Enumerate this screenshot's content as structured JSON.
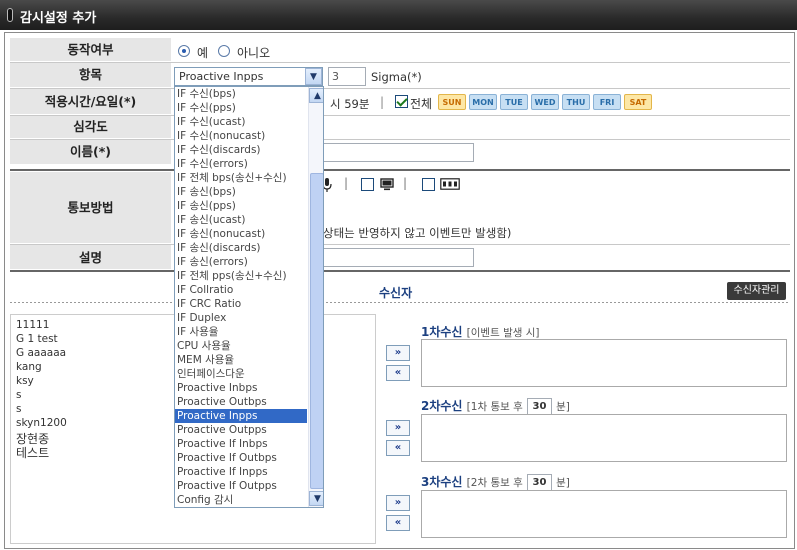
{
  "window": {
    "title": "감시설정 추가"
  },
  "form": {
    "operation": {
      "label": "동작여부",
      "yes": "예",
      "no": "아니오",
      "selected": "예"
    },
    "item": {
      "label": "항목",
      "selected": "Proactive Inpps",
      "value": "3",
      "unit": "Sigma(*)"
    },
    "schedule": {
      "label": "적용시간/요일(*)",
      "time_text": "시 59분",
      "separator": "|",
      "all_label": "전체",
      "days": [
        "SUN",
        "MON",
        "TUE",
        "WED",
        "THU",
        "FRI",
        "SAT"
      ]
    },
    "severity": {
      "label": "심각도"
    },
    "name": {
      "label": "이름(*)"
    },
    "notify": {
      "label": "통보방법",
      "sep": "|",
      "note": "상태는 반영하지 않고 이벤트만 발생함)"
    },
    "description": {
      "label": "설명"
    }
  },
  "dropdown": {
    "options": [
      "IF 수신(bps)",
      "IF 수신(pps)",
      "IF 수신(ucast)",
      "IF 수신(nonucast)",
      "IF 수신(discards)",
      "IF 수신(errors)",
      "IF 전체 bps(송신+수신)",
      "IF 송신(bps)",
      "IF 송신(pps)",
      "IF 송신(ucast)",
      "IF 송신(nonucast)",
      "IF 송신(discards)",
      "IF 송신(errors)",
      "IF 전체 pps(송신+수신)",
      "IF Collratio",
      "IF CRC Ratio",
      "IF Duplex",
      "IF 사용율",
      "CPU 사용율",
      "MEM 사용율",
      "인터페이스다운",
      "Proactive Inbps",
      "Proactive Outbps",
      "Proactive Inpps",
      "Proactive Outpps",
      "Proactive If Inbps",
      "Proactive If Outbps",
      "Proactive If Inpps",
      "Proactive If Outpps",
      "Config 감시"
    ],
    "selected": "Proactive Inpps",
    "scroll_up": "▲",
    "scroll_down": "▼"
  },
  "recipients": {
    "title": "수신자",
    "manage_button": "수신자관리",
    "list": [
      "11111",
      "G 1 test",
      "G aaaaaa",
      "kang",
      "ksy",
      "s",
      "s",
      "skyn1200",
      "장현종",
      "테스트"
    ],
    "add_button": "»",
    "remove_button": "«",
    "levels": [
      {
        "label": "1차수신",
        "note": "[이벤트 발생 시]"
      },
      {
        "label": "2차수신",
        "note_prefix": "[1차 통보 후",
        "minutes": "30",
        "note_suffix": "분]"
      },
      {
        "label": "3차수신",
        "note_prefix": "[2차 통보 후",
        "minutes": "30",
        "note_suffix": "분]"
      }
    ]
  },
  "icons": {
    "title_mark": "window-marker-icon",
    "mic": "microphone-icon",
    "monitor": "monitor-icon",
    "sms": "sms-icon"
  },
  "colors": {
    "titlebar": "#2a2a2a",
    "label_bg": "#e6e6e6",
    "selection": "#3169c6",
    "heading": "#1c4080"
  }
}
